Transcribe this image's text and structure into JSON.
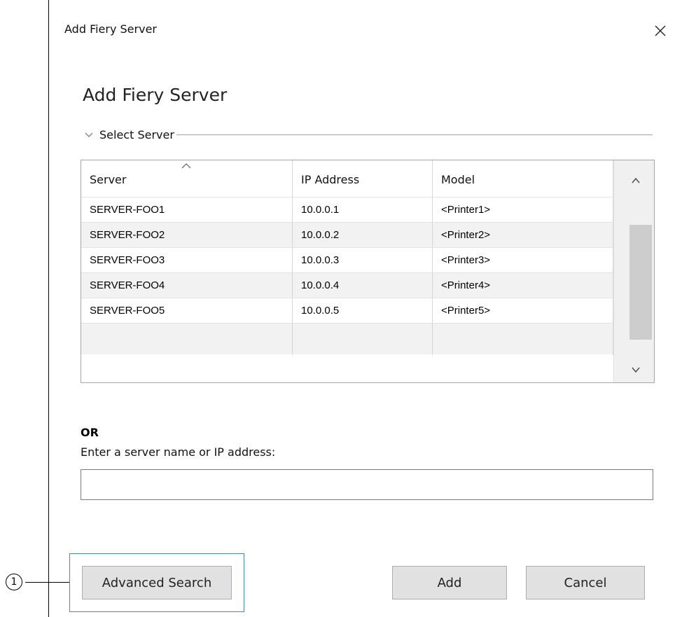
{
  "window": {
    "title": "Add Fiery Server",
    "heading": "Add Fiery Server"
  },
  "select_server": {
    "label": "Select Server",
    "columns": [
      "Server",
      "IP Address",
      "Model"
    ],
    "rows": [
      [
        "SERVER-FOO1",
        "10.0.0.1",
        "<Printer1>"
      ],
      [
        "SERVER-FOO2",
        "10.0.0.2",
        "<Printer2>"
      ],
      [
        "SERVER-FOO3",
        "10.0.0.3",
        "<Printer3>"
      ],
      [
        "SERVER-FOO4",
        "10.0.0.4",
        "<Printer4>"
      ],
      [
        "SERVER-FOO5",
        "10.0.0.5",
        "<Printer5>"
      ],
      [
        "",
        "",
        ""
      ]
    ]
  },
  "manual_entry": {
    "or_label": "OR",
    "prompt": "Enter a server name or IP address:",
    "value": ""
  },
  "buttons": {
    "advanced_search": "Advanced Search",
    "add": "Add",
    "cancel": "Cancel"
  },
  "callout": {
    "number": "1"
  },
  "icons": {
    "close": "close-icon",
    "section_toggle": "chevron-down-icon",
    "sort": "sort-ascending-icon",
    "scroll_up": "chevron-up-icon",
    "scroll_down": "chevron-down-icon"
  }
}
